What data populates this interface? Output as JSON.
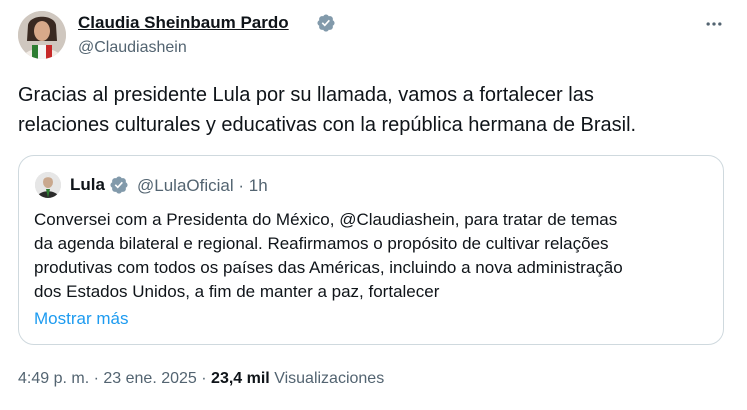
{
  "author": {
    "name": "Claudia Sheinbaum Pardo",
    "handle": "@Claudiashein"
  },
  "tweet": {
    "text_line1": "Gracias al presidente Lula por su llamada, vamos a fortalecer las",
    "text_line2": "relaciones culturales y educativas con la república hermana de Brasil."
  },
  "quote": {
    "name": "Lula",
    "handle": "@LulaOficial",
    "separator": "·",
    "time": "1h",
    "lines": [
      "Conversei com a Presidenta do México, @Claudiashein, para tratar de temas",
      "da agenda bilateral e regional. Reafirmamos o propósito de cultivar relações",
      "produtivas com todos os países das Américas, incluindo a nova administração",
      "dos Estados Unidos, a fim de manter a paz, fortalecer"
    ],
    "show_more": "Mostrar más"
  },
  "footer": {
    "time": "4:49 p. m.",
    "sep1": "·",
    "date": "23 ene. 2025",
    "sep2": "·",
    "views_count": "23,4 mil",
    "views_label": "Visualizaciones"
  },
  "colors": {
    "verified": "#829aab",
    "link": "#1d9bf0",
    "secondary_text": "#536471",
    "border": "#cfd9de"
  },
  "icons": {
    "verified": "verified-badge-icon",
    "more": "more-horizontal-icon"
  }
}
